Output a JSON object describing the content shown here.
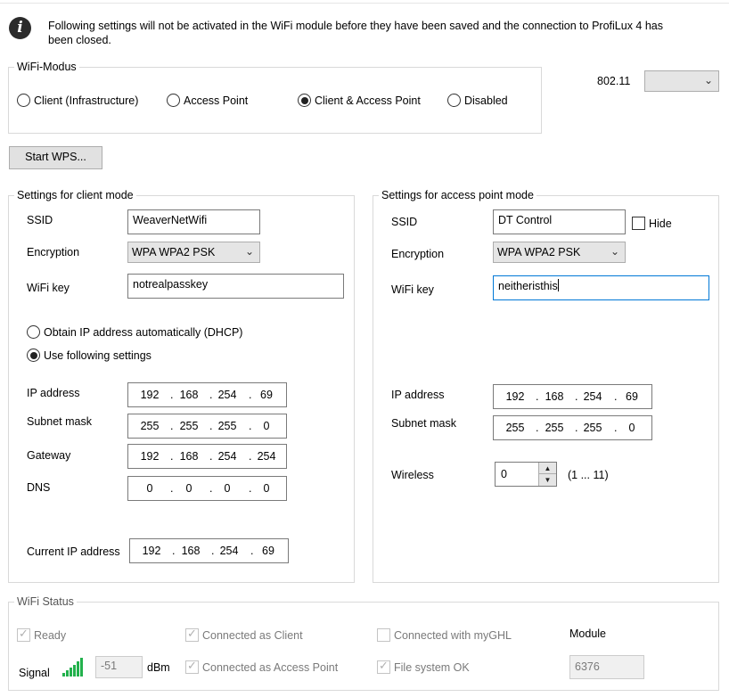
{
  "info_message": "Following settings will not be activated in the WiFi module before they have been saved and the connection to ProfiLux 4 has been closed.",
  "wifi_mode": {
    "title": "WiFi-Modus",
    "options": [
      "Client (Infrastructure)",
      "Access Point",
      "Client & Access Point",
      "Disabled"
    ],
    "selected": "Client & Access Point"
  },
  "standard": {
    "label": "802.11",
    "value": ""
  },
  "start_wps_label": "Start WPS...",
  "client": {
    "title": "Settings for client mode",
    "ssid_label": "SSID",
    "ssid": "WeaverNetWifi",
    "encryption_label": "Encryption",
    "encryption": "WPA WPA2 PSK",
    "key_label": "WiFi key",
    "key": "notrealpasskey",
    "dhcp_label": "Obtain IP address automatically (DHCP)",
    "static_label": "Use following settings",
    "ip_label": "IP address",
    "ip": [
      "192",
      "168",
      "254",
      "69"
    ],
    "subnet_label": "Subnet mask",
    "subnet": [
      "255",
      "255",
      "255",
      "0"
    ],
    "gateway_label": "Gateway",
    "gateway": [
      "192",
      "168",
      "254",
      "254"
    ],
    "dns_label": "DNS",
    "dns": [
      "0",
      "0",
      "0",
      "0"
    ],
    "current_ip_label": "Current IP address",
    "current_ip": [
      "192",
      "168",
      "254",
      "69"
    ]
  },
  "ap": {
    "title": "Settings for access point mode",
    "ssid_label": "SSID",
    "ssid": "DT Control",
    "hide_label": "Hide",
    "encryption_label": "Encryption",
    "encryption": "WPA WPA2 PSK",
    "key_label": "WiFi key",
    "key": "neitheristhis",
    "ip_label": "IP address",
    "ip": [
      "192",
      "168",
      "254",
      "69"
    ],
    "subnet_label": "Subnet mask",
    "subnet": [
      "255",
      "255",
      "255",
      "0"
    ],
    "wireless_label": "Wireless",
    "wireless_channel": "0",
    "wireless_range": "(1 ... 11)"
  },
  "status": {
    "title": "WiFi Status",
    "ready_label": "Ready",
    "connected_client_label": "Connected as Client",
    "connected_myghl_label": "Connected with myGHL",
    "module_label": "Module",
    "signal_label": "Signal",
    "signal_value": "-51",
    "signal_unit": "dBm",
    "connected_ap_label": "Connected as Access Point",
    "filesystem_label": "File system OK",
    "module_value": "6376"
  },
  "colors": {
    "accent_focus": "#0078d7",
    "signal_green": "#22b14c"
  }
}
